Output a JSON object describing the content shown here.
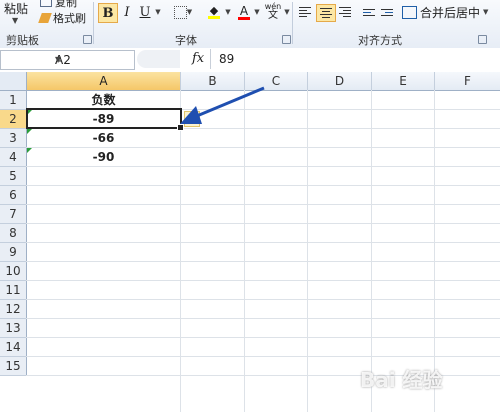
{
  "ribbon": {
    "paste_label": "粘贴",
    "copy_label": "复制",
    "format_painter_label": "格式刷",
    "bold_label": "B",
    "italic_label": "I",
    "underline_label": "U",
    "font_color_glyph": "A",
    "wen_glyph_top": "wén",
    "wen_glyph_bottom": "文",
    "merge_center_label": "合并后居中",
    "groups": {
      "clipboard": "剪贴板",
      "font": "字体",
      "alignment": "对齐方式"
    },
    "fill_color": "#ffff00",
    "font_color": "#ff0000"
  },
  "formula_bar": {
    "name_box": "A2",
    "fx_label": "fx",
    "formula": "89"
  },
  "columns": [
    "A",
    "B",
    "C",
    "D",
    "E",
    "F"
  ],
  "rows": [
    "1",
    "2",
    "3",
    "4",
    "5",
    "6",
    "7",
    "8",
    "9",
    "10",
    "11",
    "12",
    "13",
    "14",
    "15"
  ],
  "cells": {
    "A1": "负数",
    "A2": "-89",
    "A3": "-66",
    "A4": "-90"
  },
  "watermark": "Bai 经验",
  "colors": {
    "arrow": "#1f4fb0",
    "selection_header": "#f5c768",
    "error_indicator": "#2a9d3a"
  }
}
